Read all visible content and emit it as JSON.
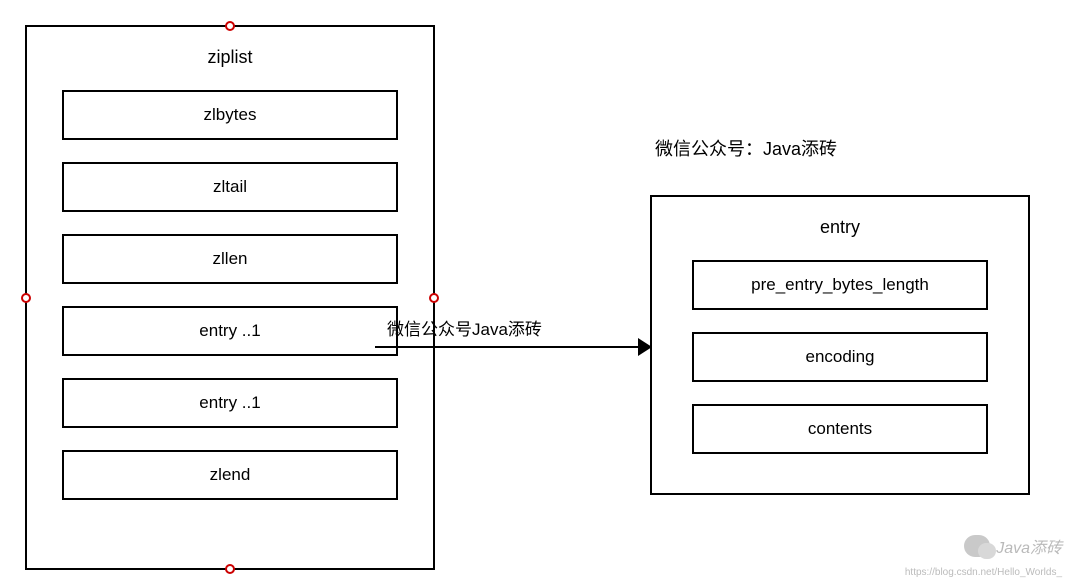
{
  "ziplist": {
    "title": "ziplist",
    "fields": [
      "zlbytes",
      "zltail",
      "zllen",
      "entry ..1",
      "entry ..1",
      "zlend"
    ]
  },
  "entry": {
    "title": "entry",
    "fields": [
      "pre_entry_bytes_length",
      "encoding",
      "contents"
    ]
  },
  "arrow_label": "微信公众号Java添砖",
  "upper_label": "微信公众号：Java添砖",
  "watermark": {
    "text": "Java添砖",
    "url": "https://blog.csdn.net/Hello_Worlds_"
  }
}
